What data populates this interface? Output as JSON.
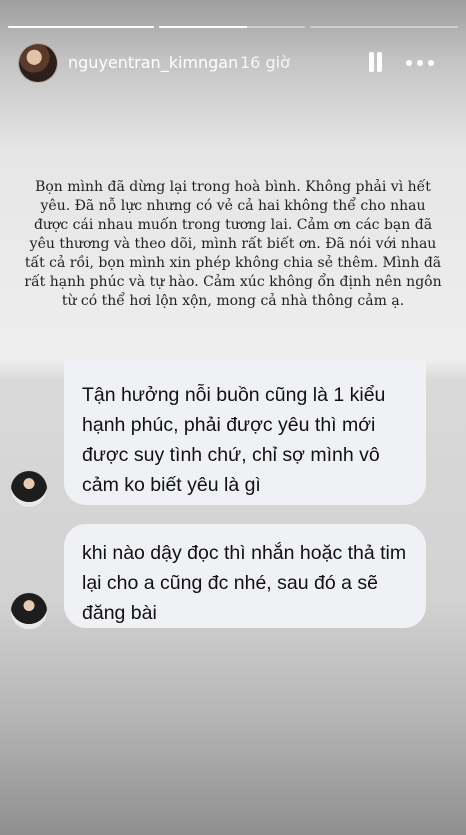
{
  "story": {
    "progress": [
      {
        "fill": 1.0
      },
      {
        "fill": 0.6
      },
      {
        "fill": 0.0
      }
    ],
    "header": {
      "username": "nguyentran_kimngan",
      "time": "16 giờ",
      "pause_icon": "pause-icon",
      "more_icon": "more-icon"
    },
    "caption": "Bọn mình đã dừng lại trong hoà bình. Không phải vì hết yêu. Đã nỗ lực nhưng có vẻ cả hai không thể cho nhau được cái nhau muốn trong tương lai. Cảm ơn các bạn đã yêu thương và theo dõi, mình rất biết ơn. Đã nói với nhau tất cả rồi, bọn mình xin phép không chia sẻ thêm. Mình đã rất hạnh phúc và tự hào. Cảm xúc không ổn định nên ngôn từ có thể hơi lộn xộn, mong cả nhà thông cảm ạ."
  },
  "chat": {
    "messages": [
      {
        "text": "Tận hưởng nỗi buồn cũng là 1 kiểu hạnh phúc, phải được yêu thì mới được suy tình chứ, chỉ sợ mình vô cảm ko biết yêu là gì"
      },
      {
        "text": "khi nào dậy đọc thì nhắn hoặc thả tim lại cho a cũng đc nhé, sau đó a sẽ đăng bài"
      }
    ]
  }
}
